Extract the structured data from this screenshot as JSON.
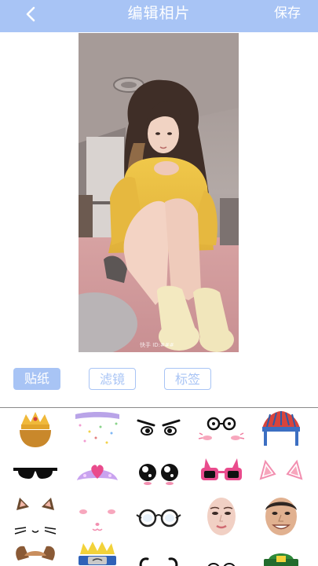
{
  "header": {
    "title": "编辑相片",
    "save_label": "保存",
    "bg_color": "#a8c4f5"
  },
  "photo": {
    "watermark": "快手 ID:###"
  },
  "tabs": [
    {
      "label": "贴纸",
      "active": true
    },
    {
      "label": "滤镜",
      "active": false
    },
    {
      "label": "标签",
      "active": false
    }
  ],
  "stickers": [
    "crown-sticker",
    "confetti-sticker",
    "angry-eyes-sticker",
    "glasses-blush-sticker",
    "feather-headdress-sticker",
    "sunglasses-sticker",
    "heart-tiara-sticker",
    "cartoon-eyes-sticker",
    "pink-bunny-glasses-sticker",
    "pink-cat-ears-sticker",
    "cat-ears-whiskers-sticker",
    "bunny-blush-sticker",
    "round-glasses-sticker",
    "woman-face-sticker",
    "man-face-sticker",
    "dog-ears-sticker",
    "naruto-headband-sticker",
    "curly-mustache-sticker",
    "eyes-sticker",
    "green-hat-sticker"
  ]
}
